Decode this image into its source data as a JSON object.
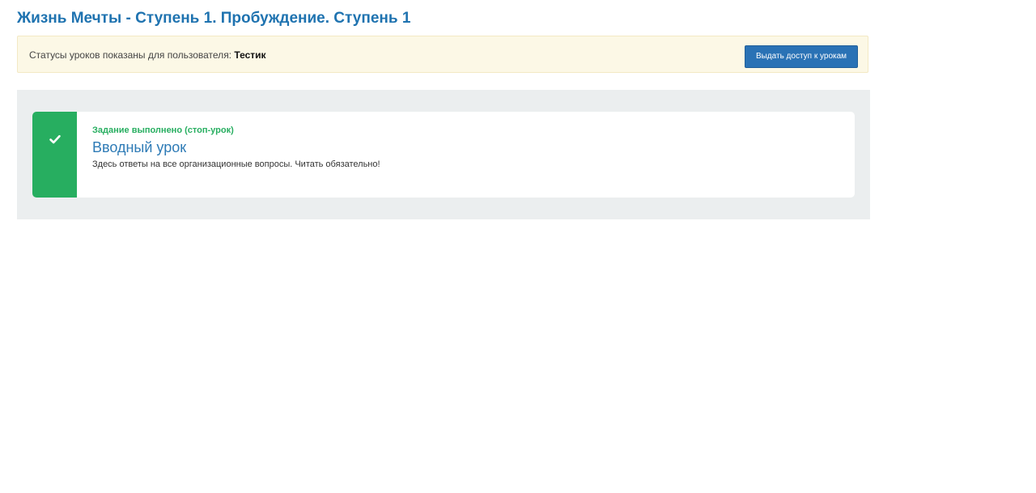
{
  "page": {
    "title": "Жизнь Мечты - Ступень 1. Пробуждение. Ступень 1"
  },
  "status_bar": {
    "text": "Статусы уроков показаны для пользователя:",
    "user": "Тестик",
    "grant_button_label": "Выдать доступ к урокам"
  },
  "lessons": [
    {
      "status_label": "Задание выполнено (стоп-урок)",
      "status_icon": "check-icon",
      "status_color": "#27ae60",
      "title": "Вводный урок",
      "description": "Здесь ответы на все организационные вопросы. Читать обязательно!"
    }
  ],
  "colors": {
    "title": "#1f73b0",
    "accent_button": "#2a72b5",
    "status_bar_bg": "#fcf8e6",
    "panel_bg": "#ebeeef",
    "completed": "#27ae60"
  }
}
